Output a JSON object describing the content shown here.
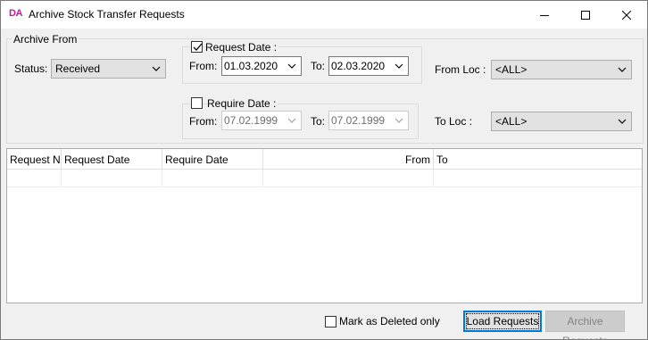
{
  "window": {
    "app_icon": "DA",
    "title": "Archive Stock Transfer Requests",
    "controls": [
      "minimize-icon",
      "maximize-icon",
      "close-icon"
    ]
  },
  "filters": {
    "group_title": "Archive From",
    "status_label": "Status:",
    "status_value": "Received",
    "request_date": {
      "checked": true,
      "label": "Request Date :",
      "from_label": "From:",
      "from_value": "01.03.2020",
      "to_label": "To:",
      "to_value": "02.03.2020"
    },
    "require_date": {
      "checked": false,
      "label": "Require Date :",
      "from_label": "From:",
      "from_value": "07.02.1999",
      "to_label": "To:",
      "to_value": "07.02.1999"
    },
    "from_loc_label": "From Loc :",
    "from_loc_value": "<ALL>",
    "to_loc_label": "To Loc :",
    "to_loc_value": "<ALL>"
  },
  "grid": {
    "columns": [
      "Request N",
      "Request Date",
      "Require Date",
      "From",
      "To"
    ],
    "rows": []
  },
  "footer": {
    "mark_deleted_label": "Mark as Deleted only",
    "mark_deleted_checked": false,
    "load_button": "Load Requests",
    "archive_button": "Archive Requests"
  }
}
